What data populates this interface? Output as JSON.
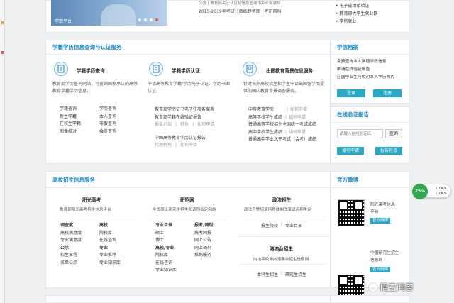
{
  "top": {
    "banner_label": "学职平台",
    "center_line1": "公告 | 教育部关于认证及信息查询相关业务通知",
    "center_line2": "2015-2019年考研分数线趋势图 | 考研百科",
    "right_items": [
      "电子成绩单验证",
      "教育部大学生就业网",
      "学信就业"
    ]
  },
  "section1": {
    "title": "学籍学历信息查询与认证服务",
    "cols": [
      {
        "title": "学籍学历查询",
        "desc": "教育部学历查询网站，可查询国家承认的高等教育学籍学历信息。",
        "links": [
          [
            "学籍查询",
            "学历查询"
          ],
          [
            "新生学籍",
            "本人查询"
          ],
          [
            "在校生学籍",
            "零散查询"
          ],
          [
            "图像校对",
            "会员查询"
          ]
        ]
      },
      {
        "title": "学籍学历认证",
        "desc": "申请高等教育学籍/学历电子认证、学历书面认证。",
        "links": [
          "教育部学历证书电子注册备案表",
          "教育部学籍在线验证报告"
        ],
        "sub": [
          "报告介绍",
          "特色",
          "如何申请"
        ],
        "links2": [
          "中国高等教育学历认证报告"
        ],
        "sub2": [
          "代理机构",
          "如何申请"
        ]
      },
      {
        "title": "出国教育背景信息服务",
        "desc": "针对境外高校招生和学生申请出国留学而提供的国内教育背景调查服务。",
        "links": [
          "中等教育学历",
          "高等学校学生成绩",
          "普通高等学校招生全国统一考试成绩",
          "高中学校学生成绩",
          "普通高中学业水平考试（会考）成绩"
        ],
        "sub": [
          "如何申请",
          "如何申请",
          "如何申请",
          "如何申请",
          "如何申请"
        ]
      }
    ],
    "side": {
      "title": "学信档案",
      "lines": [
        "免费查询本人学籍学历信息",
        "申请在线验证报告",
        "应届毕业生可校对本人学历照片"
      ],
      "login": "登录",
      "register": "注册"
    },
    "verify": {
      "title": "在线验证报告",
      "placeholder": "请输入在线验证码",
      "query": "查询",
      "apply": "如何申请",
      "features": "报告特点"
    }
  },
  "section2": {
    "title": "高校招生信息服务",
    "col1": {
      "title": "阳光高考",
      "desc": "教育部阳光高考招生信息平台",
      "rows": [
        [
          "调查度",
          "高校"
        ],
        [
          "高校满意度",
          "院校库"
        ],
        [
          "专业满意度",
          "在线咨询"
        ],
        [
          "公示",
          "专业"
        ],
        [
          "招生章程",
          "专业推荐"
        ],
        [
          "名单公示",
          "专业知识库"
        ]
      ]
    },
    "col2": {
      "title": "研招网",
      "desc": "全国硕士研究生招生和调剂指定网站",
      "rows": [
        [
          "专业目录",
          "报考/调剂"
        ],
        [
          "硕士",
          "统考网报"
        ],
        [
          "博士",
          "网上公告"
        ],
        [
          "高校/专业",
          "网上调剂"
        ],
        [
          "院校库",
          "推免服务"
        ],
        [
          "在线咨询",
          ""
        ],
        [
          "专业知识库",
          ""
        ]
      ]
    },
    "col3": {
      "title1": "政法招生",
      "desc1": "政法干警招录培养体制改革试点招生网",
      "links1": [
        "报生院校",
        "专业目录"
      ],
      "title2": "港澳台招生",
      "desc2": "内地高校面向港澳台招生信息网",
      "links2": [
        "本科生招生",
        "研究生招生"
      ]
    },
    "side": {
      "title": "官方微博",
      "w1_line1": "阳光高考信息",
      "w1_line2": "平台",
      "w1_btn": "官方微博",
      "w2_line1": "中国研究生招生",
      "w2_line2": "信息网",
      "w2_btn": "官方微博"
    }
  },
  "widget": {
    "percent": "25%",
    "line1": "0K/s",
    "line2": "0K/s"
  },
  "watermark": "悟空问答",
  "colors": {
    "accent": "#1c8cc7",
    "button": "#27a9c6"
  }
}
